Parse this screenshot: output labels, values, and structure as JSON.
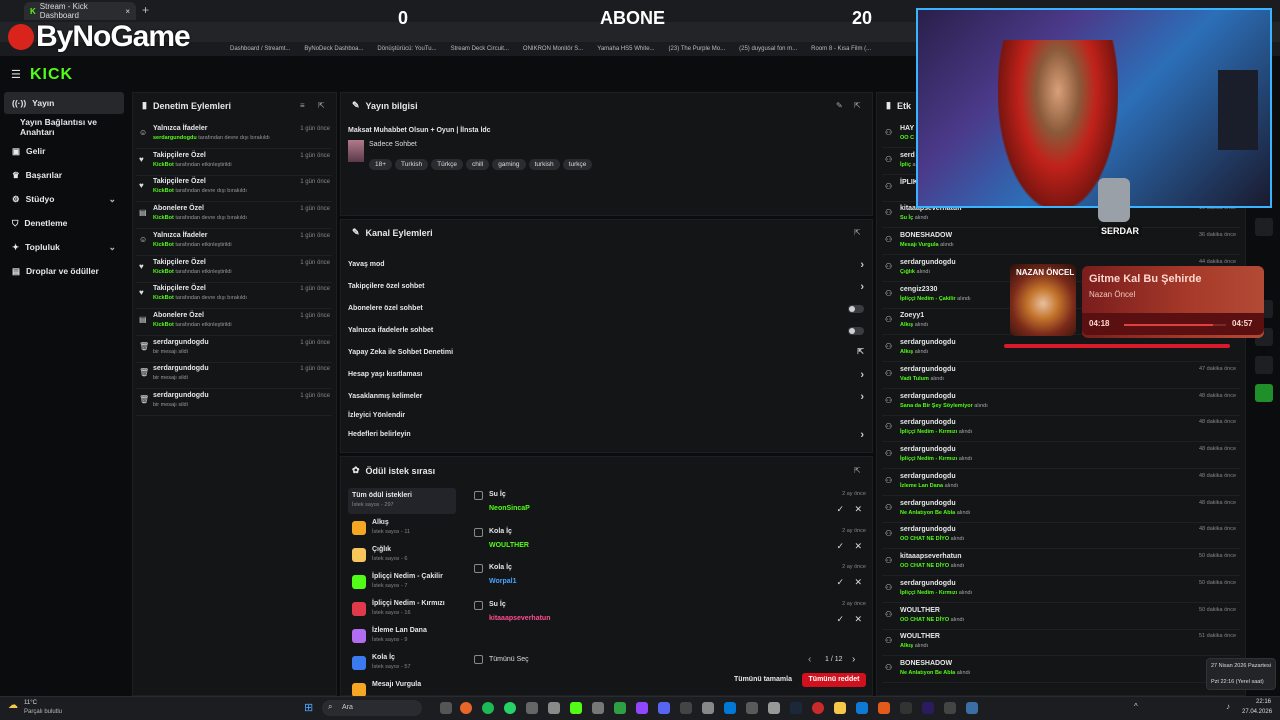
{
  "browser": {
    "tab_title": "Stream - Kick Dashboard",
    "brand_logo": "ByNoGame",
    "bookmarks": [
      "Dashboard / Streamt...",
      "ByNoDeck Dashboa...",
      "Dönüştürücü: YouTu...",
      "Stream Deck Circuit...",
      "ONIKRON Monitör S...",
      "Yamaha HS5 White...",
      "(23) The Purple Mo...",
      "(25) duygusal fon m...",
      "Room 8 - Kısa Film (..."
    ]
  },
  "overlay": {
    "left_number": "0",
    "title": "ABONE",
    "right_number": "20"
  },
  "kick": {
    "logo": "KICK"
  },
  "sidebar": {
    "items": [
      {
        "label": "Yayın",
        "icon": "broadcast-icon"
      },
      {
        "label": "Yayın Bağlantısı ve Anahtarı"
      },
      {
        "label": "Gelir",
        "icon": "revenue-icon"
      },
      {
        "label": "Başarılar",
        "icon": "trophy-icon"
      },
      {
        "label": "Stüdyo",
        "icon": "studio-icon"
      },
      {
        "label": "Denetleme",
        "icon": "shield-icon"
      },
      {
        "label": "Topluluk",
        "icon": "community-icon"
      },
      {
        "label": "Droplar ve ödüller",
        "icon": "gift-icon"
      }
    ]
  },
  "moderation": {
    "title": "Denetim Eylemleri",
    "rows": [
      {
        "title": "Yalnızca İfadeler",
        "actor": "serdargundogdu",
        "action": "tarafından devre dışı bırakıldı",
        "time": "1 gün önce"
      },
      {
        "title": "Takipçilere Özel",
        "actor": "KickBot",
        "action": "tarafından etkinleştirildi",
        "time": "1 gün önce"
      },
      {
        "title": "Takipçilere Özel",
        "actor": "KickBot",
        "action": "tarafından devre dışı bırakıldı",
        "time": "1 gün önce"
      },
      {
        "title": "Abonelere Özel",
        "actor": "KickBot",
        "action": "tarafından devre dışı bırakıldı",
        "time": "1 gün önce"
      },
      {
        "title": "Yalnızca İfadeler",
        "actor": "KickBot",
        "action": "tarafından etkinleştirildi",
        "time": "1 gün önce"
      },
      {
        "title": "Takipçilere Özel",
        "actor": "KickBot",
        "action": "tarafından etkinleştirildi",
        "time": "1 gün önce"
      },
      {
        "title": "Takipçilere Özel",
        "actor": "KickBot",
        "action": "tarafından devre dışı bırakıldı",
        "time": "1 gün önce"
      },
      {
        "title": "Abonelere Özel",
        "actor": "KickBot",
        "action": "tarafından etkinleştirildi",
        "time": "1 gün önce"
      },
      {
        "title": "serdargundogdu",
        "actor": "",
        "action": "bir mesajı sildi",
        "time": "1 gün önce"
      },
      {
        "title": "serdargundogdu",
        "actor": "",
        "action": "bir mesajı sildi",
        "time": "1 gün önce"
      },
      {
        "title": "serdargundogdu",
        "actor": "",
        "action": "bir mesajı sildi",
        "time": "1 gün önce"
      }
    ]
  },
  "stream_info": {
    "title": "Yayın bilgisi",
    "stream_title": "Maksat Muhabbet Olsun + Oyun | İlnsta ldc",
    "category": "Sadece Sohbet",
    "tags": [
      "18+",
      "Turkish",
      "Türkçe",
      "chill",
      "gaming",
      "turkish",
      "turkçe"
    ]
  },
  "channel_actions": {
    "title": "Kanal Eylemleri",
    "rows": [
      {
        "label": "Yavaş mod",
        "control": "arrow"
      },
      {
        "label": "Takipçilere özel sohbet",
        "control": "arrow"
      },
      {
        "label": "Abonelere özel sohbet",
        "control": "toggle"
      },
      {
        "label": "Yalnızca ifadelerle sohbet",
        "control": "toggle"
      },
      {
        "label": "Yapay Zeka ile Sohbet Denetimi",
        "control": "external"
      },
      {
        "label": "Hesap yaşı kısıtlaması",
        "control": "arrow"
      },
      {
        "label": "Yasaklanmış kelimeler",
        "control": "arrow"
      },
      {
        "label": "İzleyici Yönlendir",
        "control": "none"
      },
      {
        "label": "Hedefleri belirleyin",
        "control": "arrow"
      }
    ]
  },
  "rewards": {
    "title": "Ödül istek sırası",
    "categories": [
      {
        "name": "Tüm ödül istekleri",
        "count": "İstek sayısı - 297",
        "color": ""
      },
      {
        "name": "Alkış",
        "count": "İstek sayısı - 11",
        "color": "#f5a623"
      },
      {
        "name": "Çığlık",
        "count": "İstek sayısı - 6",
        "color": "#f7c65a"
      },
      {
        "name": "İpliççi Nedim - Çakilir",
        "count": "İstek sayısı - 7",
        "color": "#53fc18"
      },
      {
        "name": "İpliççi Nedim - Kırmızı",
        "count": "İstek sayısı - 16",
        "color": "#e03a4a"
      },
      {
        "name": "İzleme Lan Dana",
        "count": "İstek sayısı - 9",
        "color": "#b16cf0"
      },
      {
        "name": "Kola İç",
        "count": "İstek sayısı - 57",
        "color": "#3a7bf0"
      },
      {
        "name": "Mesajı Vurgula",
        "count": "",
        "color": "#f5a623"
      }
    ],
    "requests": [
      {
        "reward": "Su İç",
        "user": "NeonSincaP",
        "user_color": "#53fc18",
        "time": "2 ay önce"
      },
      {
        "reward": "Kola İç",
        "user": "WOULTHER",
        "user_color": "#53fc18",
        "time": "2 ay önce"
      },
      {
        "reward": "Kola İç",
        "user": "Worpal1",
        "user_color": "#4aa3ff",
        "time": "2 ay önce"
      },
      {
        "reward": "Su İç",
        "user": "kitaaapseverhatun",
        "user_color": "#ff4d8d",
        "time": "2 ay önce"
      }
    ],
    "select_all": "Tümünü Seç",
    "pagination": "1 / 12",
    "complete_all": "Tümünü tamamla",
    "reject_all": "Tümünü reddet"
  },
  "activity": {
    "title": "Etk",
    "events": [
      {
        "user": "HAY",
        "reward": "OO C",
        "time": ""
      },
      {
        "user": "serd",
        "reward": "İpliç",
        "time": ""
      },
      {
        "user": "İPLIK",
        "reward": "",
        "time": ""
      },
      {
        "user": "kitaaapseverhatun",
        "reward": "Su İç",
        "time": "16 dakika önce"
      },
      {
        "user": "BONESHADOW",
        "reward": "Mesajı Vurgula",
        "time": "36 dakika önce"
      },
      {
        "user": "serdargundogdu",
        "reward": "Çığlık",
        "time": "44 dakika önce"
      },
      {
        "user": "cengiz2330",
        "reward": "İpliççi Nedim - Çakilir",
        "time": ""
      },
      {
        "user": "Zoeyy1",
        "reward": "Alkış",
        "time": ""
      },
      {
        "user": "serdargundogdu",
        "reward": "Alkış",
        "time": ""
      },
      {
        "user": "serdargundogdu",
        "reward": "Vadi Tulum",
        "time": "47 dakika önce"
      },
      {
        "user": "serdargundogdu",
        "reward": "Sana da Bir Şey Söylemiyor",
        "time": "48 dakika önce"
      },
      {
        "user": "serdargundogdu",
        "reward": "İpliççi Nedim - Kırmızı",
        "time": "48 dakika önce"
      },
      {
        "user": "serdargundogdu",
        "reward": "İpliççi Nedim - Kırmızı",
        "time": "48 dakika önce"
      },
      {
        "user": "serdargundogdu",
        "reward": "İzleme Lan Dana",
        "time": "48 dakika önce"
      },
      {
        "user": "serdargundogdu",
        "reward": "Ne Anlatıyon Be Abla",
        "time": "48 dakika önce"
      },
      {
        "user": "serdargundogdu",
        "reward": "OO CHAT NE DİYO",
        "time": "48 dakika önce"
      },
      {
        "user": "kitaaapseverhatun",
        "reward": "OO CHAT NE DİYO",
        "time": "50 dakika önce"
      },
      {
        "user": "serdargundogdu",
        "reward": "İpliççi Nedim - Kırmızı",
        "time": "50 dakika önce"
      },
      {
        "user": "WOULTHER",
        "reward": "OO CHAT NE DİYO",
        "time": "50 dakika önce"
      },
      {
        "user": "WOULTHER",
        "reward": "Alkış",
        "time": "51 dakika önce"
      },
      {
        "user": "BONESHADOW",
        "reward": "Ne Anlatıyon Be Abla",
        "time": "51"
      }
    ],
    "claimed_suffix": "alındı"
  },
  "webcam": {
    "badge": "SERDAR"
  },
  "music": {
    "title": "Gitme Kal Bu Şehirde",
    "artist": "Nazan Öncel",
    "elapsed": "04:18",
    "duration": "04:57",
    "progress": 0.87,
    "cover_text": "NAZAN ÖNCEL"
  },
  "taskbar": {
    "weather_temp": "11°C",
    "weather_desc": "Parçalı bulutlu",
    "search": "Ara",
    "time": "22:16",
    "date": "27.04.2026",
    "tooltip_date": "27 Nisan 2026 Pazartesi",
    "tooltip_time": "Pzt 22:16 (Yerel saat)"
  }
}
